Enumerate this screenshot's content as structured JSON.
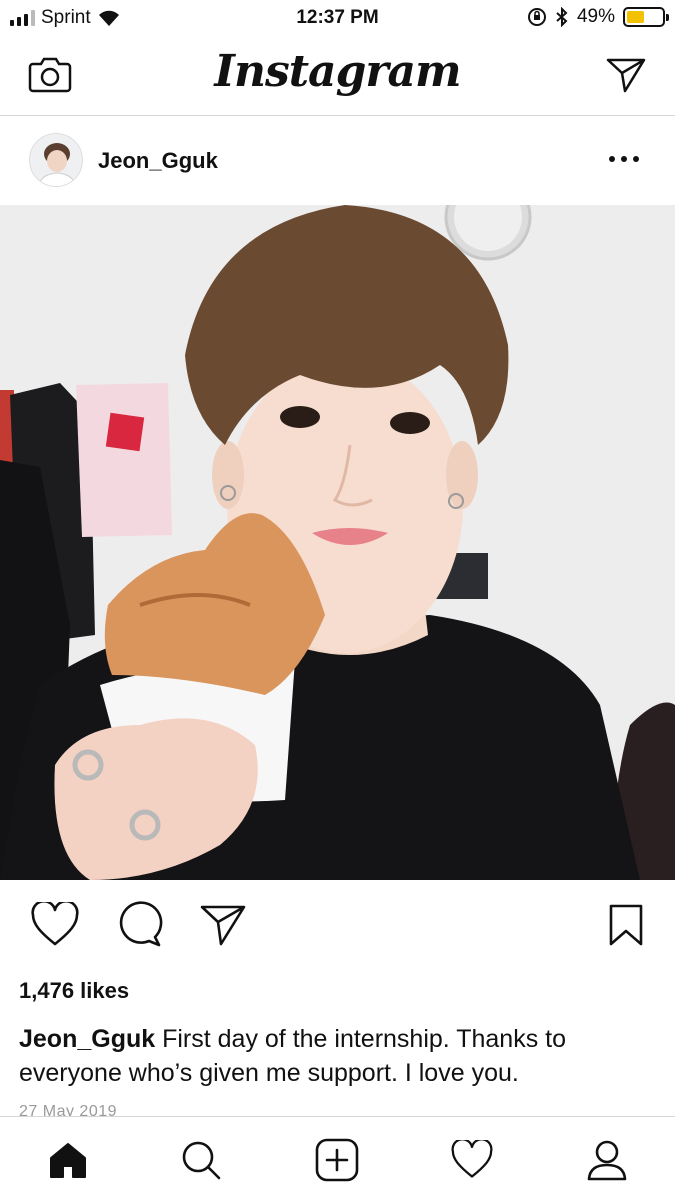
{
  "status_bar": {
    "carrier": "Sprint",
    "time": "12:37 PM",
    "battery_percent": "49%",
    "battery_level": 0.49,
    "battery_color": "#f2c200",
    "icons": [
      "signal-icon",
      "wifi-icon",
      "orientation-lock-icon",
      "bluetooth-icon",
      "battery-icon"
    ]
  },
  "header": {
    "logo_text": "Instagram",
    "left_icon": "camera-icon",
    "right_icon": "direct-message-icon"
  },
  "post": {
    "username": "Jeon_Gguk",
    "more_icon": "more-options-icon",
    "photo_description_icon": "post-photo",
    "actions": [
      "like-icon",
      "comment-icon",
      "share-icon",
      "bookmark-icon"
    ],
    "likes": "1,476 likes",
    "caption_username": "Jeon_Gguk",
    "caption_text": " First day of the internship. Thanks to everyone who’s given me support. I love you.",
    "date": "27 May 2019"
  },
  "bottom_nav": {
    "items": [
      "home-icon",
      "search-icon",
      "new-post-icon",
      "activity-icon",
      "profile-icon"
    ],
    "active": "home-icon"
  }
}
